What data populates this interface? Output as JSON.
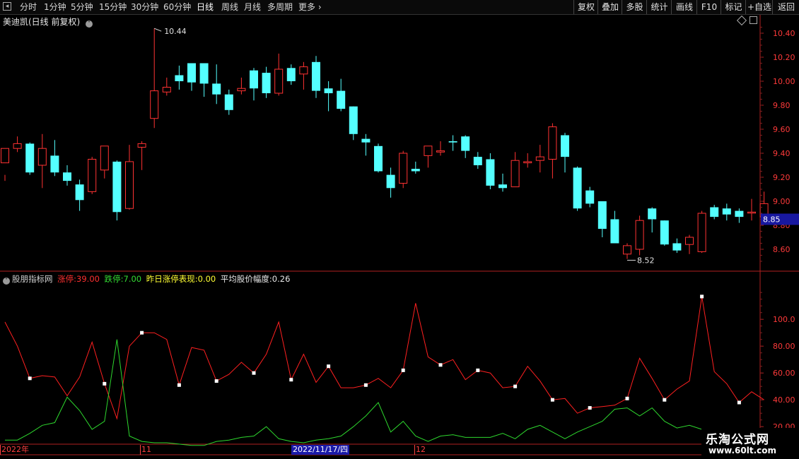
{
  "toolbar": {
    "back_icon": "back-icon",
    "periods": [
      "分时",
      "1分钟",
      "5分钟",
      "15分钟",
      "30分钟",
      "60分钟",
      "日线",
      "周线",
      "月线",
      "多周期",
      "更多"
    ],
    "active_period": "日线",
    "right_buttons": [
      "复权",
      "叠加",
      "多股",
      "统计",
      "画线",
      "F10",
      "标记",
      "+自选",
      "返回"
    ]
  },
  "main_chart": {
    "title": "美迪凯(日线 前复权)",
    "price_ticks": [
      "10.40",
      "10.20",
      "10.00",
      "9.80",
      "9.60",
      "9.40",
      "9.20",
      "9.00",
      "8.80",
      "8.60"
    ],
    "current_price": "8.85",
    "high_label": "10.44",
    "low_label": "8.52",
    "up_color": "#ff3232",
    "down_color": "#54ffff"
  },
  "indicator": {
    "name": "股朋指标网",
    "zt_label": "涨停:",
    "zt_value": "39.00",
    "dt_label": "跌停:",
    "dt_value": "7.00",
    "zr_label": "昨日涨停表现:",
    "zr_value": "0.00",
    "pj_label": "平均股价幅度:",
    "pj_value": "0.26",
    "ticks": [
      "100.0",
      "80.00",
      "60.00",
      "40.00",
      "20.00"
    ]
  },
  "date_bar": {
    "labels": [
      "2022年",
      "11",
      "2022/11/17/四",
      "12"
    ]
  },
  "watermark": {
    "title": "乐淘公式网",
    "url": "www.60lt.com"
  },
  "chart_data": {
    "type": "candlestick",
    "ylim": [
      8.45,
      10.56
    ],
    "candles": [
      [
        9.32,
        9.44,
        9.22,
        9.17
      ],
      [
        9.44,
        9.48,
        9.54,
        9.41
      ],
      [
        9.48,
        9.24,
        9.49,
        9.22
      ],
      [
        9.3,
        9.44,
        9.56,
        9.11
      ],
      [
        9.38,
        9.24,
        9.51,
        9.21
      ],
      [
        9.24,
        9.17,
        9.3,
        9.13
      ],
      [
        9.14,
        9.01,
        9.18,
        8.92
      ],
      [
        9.08,
        9.35,
        9.37,
        9.06
      ],
      [
        9.26,
        9.46,
        9.46,
        9.19
      ],
      [
        9.33,
        8.91,
        9.34,
        8.84
      ],
      [
        8.94,
        9.33,
        9.47,
        8.93
      ],
      [
        9.45,
        9.48,
        9.5,
        9.26
      ],
      [
        9.69,
        9.92,
        10.44,
        9.61
      ],
      [
        9.91,
        9.95,
        10.03,
        9.88
      ],
      [
        10.05,
        10.0,
        10.13,
        9.93
      ],
      [
        10.15,
        9.99,
        10.15,
        9.92
      ],
      [
        10.15,
        9.98,
        10.15,
        9.87
      ],
      [
        9.98,
        9.89,
        10.14,
        9.81
      ],
      [
        9.89,
        9.76,
        9.93,
        9.72
      ],
      [
        9.92,
        9.94,
        10.03,
        9.89
      ],
      [
        10.09,
        9.94,
        10.11,
        9.84
      ],
      [
        10.07,
        9.9,
        10.12,
        9.86
      ],
      [
        9.9,
        10.1,
        10.23,
        9.88
      ],
      [
        10.11,
        10.0,
        10.14,
        9.97
      ],
      [
        10.06,
        10.12,
        10.16,
        9.93
      ],
      [
        10.16,
        9.92,
        10.21,
        9.86
      ],
      [
        9.94,
        9.9,
        10.0,
        9.75
      ],
      [
        9.92,
        9.77,
        10.02,
        9.75
      ],
      [
        9.79,
        9.56,
        9.79,
        9.51
      ],
      [
        9.52,
        9.49,
        9.56,
        9.38
      ],
      [
        9.46,
        9.25,
        9.48,
        9.24
      ],
      [
        9.22,
        9.11,
        9.28,
        9.03
      ],
      [
        9.15,
        9.4,
        9.42,
        9.11
      ],
      [
        9.27,
        9.25,
        9.33,
        9.23
      ],
      [
        9.38,
        9.46,
        9.42,
        9.28
      ],
      [
        9.41,
        9.42,
        9.5,
        9.38
      ],
      [
        9.5,
        9.49,
        9.55,
        9.42
      ],
      [
        9.54,
        9.42,
        9.55,
        9.36
      ],
      [
        9.37,
        9.3,
        9.41,
        9.27
      ],
      [
        9.35,
        9.13,
        9.4,
        9.1
      ],
      [
        9.14,
        9.11,
        9.23,
        9.08
      ],
      [
        9.12,
        9.34,
        9.41,
        9.12
      ],
      [
        9.32,
        9.33,
        9.4,
        9.28
      ],
      [
        9.34,
        9.37,
        9.47,
        9.24
      ],
      [
        9.35,
        9.62,
        9.65,
        9.19
      ],
      [
        9.55,
        9.37,
        9.57,
        9.24
      ],
      [
        9.28,
        8.94,
        9.29,
        8.92
      ],
      [
        9.09,
        8.98,
        9.12,
        8.95
      ],
      [
        9.0,
        8.77,
        9.0,
        8.7
      ],
      [
        8.85,
        8.65,
        8.92,
        8.65
      ],
      [
        8.56,
        8.63,
        8.65,
        8.52
      ],
      [
        8.6,
        8.84,
        8.88,
        8.55
      ],
      [
        8.94,
        8.85,
        8.95,
        8.74
      ],
      [
        8.84,
        8.64,
        8.84,
        8.63
      ],
      [
        8.65,
        8.59,
        8.69,
        8.57
      ],
      [
        8.64,
        8.7,
        8.72,
        8.56
      ],
      [
        8.58,
        8.9,
        8.92,
        8.57
      ],
      [
        8.95,
        8.87,
        8.97,
        8.85
      ],
      [
        8.94,
        8.89,
        8.98,
        8.84
      ],
      [
        8.92,
        8.87,
        8.94,
        8.82
      ],
      [
        8.91,
        8.91,
        9.02,
        8.84
      ],
      [
        8.87,
        8.98,
        9.08,
        8.85
      ]
    ],
    "indicator_series": [
      {
        "name": "涨停",
        "color": "#ff2020",
        "values": [
          98,
          80,
          56,
          58,
          57,
          43,
          57,
          83,
          52,
          26,
          80,
          90,
          90,
          85,
          51,
          79,
          77,
          54,
          59,
          68,
          60,
          74,
          98,
          55,
          74,
          53,
          65,
          49,
          49,
          51,
          56,
          49,
          62,
          112,
          72,
          66,
          70,
          55,
          62,
          60,
          49,
          50,
          65,
          54,
          40,
          41,
          30,
          34,
          35,
          36,
          41,
          71,
          56,
          40,
          48,
          54,
          117,
          61,
          52,
          38,
          46,
          40
        ]
      },
      {
        "name": "跌停",
        "color": "#2ed82e",
        "values": [
          10,
          10,
          15,
          21,
          23,
          42,
          32,
          18,
          24,
          85,
          13,
          9,
          8,
          8,
          7,
          6,
          6,
          9,
          10,
          12,
          13,
          20,
          11,
          9,
          8,
          10,
          11,
          13,
          20,
          28,
          38,
          16,
          24,
          13,
          9,
          13,
          14,
          12,
          12,
          12,
          15,
          11,
          18,
          21,
          16,
          11,
          16,
          20,
          24,
          33,
          34,
          28,
          34,
          24,
          19,
          21,
          18,
          13,
          11,
          13,
          17,
          14
        ]
      }
    ],
    "ind_ylim": [
      6,
      120
    ]
  }
}
